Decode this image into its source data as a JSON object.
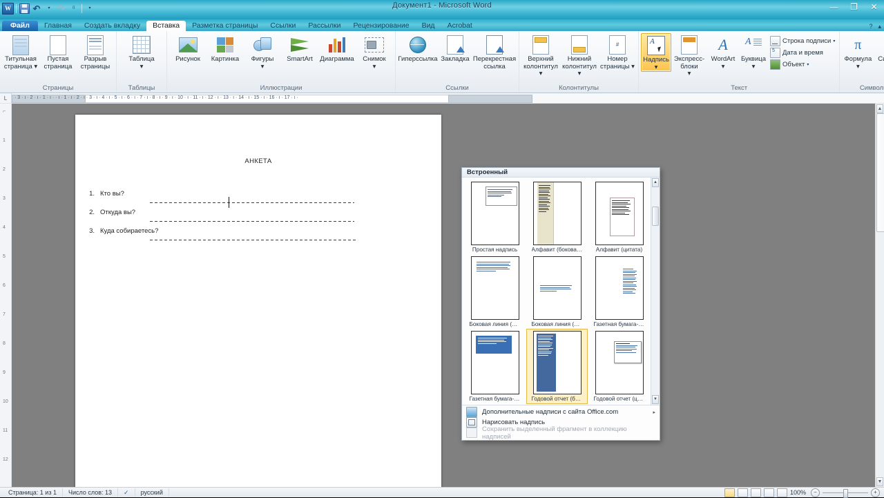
{
  "window": {
    "title": "Документ1 - Microsoft Word",
    "minimize": "—",
    "restore": "❐",
    "close": "✕"
  },
  "quick_access": {
    "word_logo": "W",
    "save": "save-icon",
    "undo": "↶",
    "undo_arrow": "▾",
    "redo": "↷",
    "customize": "▾"
  },
  "tabs": [
    {
      "label": "Файл",
      "kind": "file"
    },
    {
      "label": "Главная",
      "kind": "normal"
    },
    {
      "label": "Создать вкладку",
      "kind": "normal"
    },
    {
      "label": "Вставка",
      "kind": "active"
    },
    {
      "label": "Разметка страницы",
      "kind": "normal"
    },
    {
      "label": "Ссылки",
      "kind": "normal"
    },
    {
      "label": "Рассылки",
      "kind": "normal"
    },
    {
      "label": "Рецензирование",
      "kind": "normal"
    },
    {
      "label": "Вид",
      "kind": "normal"
    },
    {
      "label": "Acrobat",
      "kind": "normal"
    }
  ],
  "ribbon": {
    "groups": [
      {
        "label": "Страницы",
        "buttons": [
          {
            "label": "Титульная страница",
            "dropdown": true
          },
          {
            "label": "Пустая страница",
            "dropdown": false
          },
          {
            "label": "Разрыв страницы",
            "dropdown": false
          }
        ]
      },
      {
        "label": "Таблицы",
        "buttons": [
          {
            "label": "Таблица",
            "dropdown": true
          }
        ]
      },
      {
        "label": "Иллюстрации",
        "buttons": [
          {
            "label": "Рисунок",
            "dropdown": false
          },
          {
            "label": "Картинка",
            "dropdown": false
          },
          {
            "label": "Фигуры",
            "dropdown": true
          },
          {
            "label": "SmartArt",
            "dropdown": false
          },
          {
            "label": "Диаграмма",
            "dropdown": false
          },
          {
            "label": "Снимок",
            "dropdown": true
          }
        ]
      },
      {
        "label": "Ссылки",
        "buttons": [
          {
            "label": "Гиперссылка",
            "dropdown": false
          },
          {
            "label": "Закладка",
            "dropdown": false
          },
          {
            "label": "Перекрестная ссылка",
            "dropdown": false
          }
        ]
      },
      {
        "label": "Колонтитулы",
        "buttons": [
          {
            "label": "Верхний колонтитул",
            "dropdown": true
          },
          {
            "label": "Нижний колонтитул",
            "dropdown": true
          },
          {
            "label": "Номер страницы",
            "dropdown": true
          }
        ]
      },
      {
        "label": "Текст",
        "buttons": [
          {
            "label": "Надпись",
            "dropdown": true,
            "highlighted": true
          },
          {
            "label": "Экспресс-блоки",
            "dropdown": true
          },
          {
            "label": "WordArt",
            "dropdown": true
          },
          {
            "label": "Буквица",
            "dropdown": true
          }
        ],
        "small_buttons": [
          {
            "label": "Строка подписи",
            "dropdown": true
          },
          {
            "label": "Дата и время",
            "dropdown": false
          },
          {
            "label": "Объект",
            "dropdown": true
          }
        ]
      },
      {
        "label": "Символы",
        "buttons": [
          {
            "label": "Формула",
            "dropdown": true
          },
          {
            "label": "Символ",
            "dropdown": true
          }
        ]
      }
    ],
    "collapse_icon": "▴"
  },
  "ruler": {
    "corner_marker": "L",
    "ticks": "· 3 · ı · 2 · ı · 1 · ı ·      · ı · 1 · ı · 2 · ı · 3 · ı · 4 · ı · 5 · ı · 6 · ı · 7 · ı · 8 · ı · 9 · ı · 10 · ı · 11 · ı · 12 · ı · 13 · ı · 14 · ı · 15 · ı · 16 · ı · 17 · ı ·"
  },
  "document": {
    "title": "АНКЕТА",
    "questions": [
      {
        "num": "1.",
        "text": "Кто вы?"
      },
      {
        "num": "2.",
        "text": "Откуда вы?"
      },
      {
        "num": "3.",
        "text": "Куда собираетесь?"
      }
    ]
  },
  "gallery": {
    "header": "Встроенный",
    "scroll_up": "▲",
    "scroll_down": "▼",
    "items": [
      {
        "label": "Простая надпись",
        "style": "simple"
      },
      {
        "label": "Алфавит (боковая по...",
        "style": "alphabet-side"
      },
      {
        "label": "Алфавит (цитата)",
        "style": "alphabet-quote"
      },
      {
        "label": "Боковая линия (боко...",
        "style": "sideline-side"
      },
      {
        "label": "Боковая линия (цитата)",
        "style": "sideline-quote"
      },
      {
        "label": "Газетная бумага-боко...",
        "style": "news-side"
      },
      {
        "label": "Газетная бумага-брос...",
        "style": "news-pull"
      },
      {
        "label": "Годовой отчет (боков...",
        "style": "annual-side"
      },
      {
        "label": "Годовой отчет (цитата)",
        "style": "annual-quote"
      }
    ],
    "menu": [
      {
        "label": "Дополнительные надписи с сайта Office.com",
        "icon": "office-online-icon",
        "submenu": "▸",
        "disabled": false
      },
      {
        "label": "Нарисовать надпись",
        "icon": "draw-textbox-icon",
        "submenu": "",
        "disabled": false
      },
      {
        "label": "Сохранить выделенный фрагмент в коллекцию надписей",
        "icon": "save-selection-icon",
        "submenu": "",
        "disabled": true
      }
    ]
  },
  "status_bar": {
    "page": "Страница: 1 из 1",
    "words": "Число слов: 13",
    "proofing_icon": "spellcheck-icon",
    "language": "русский",
    "views": [
      "print-layout",
      "full-screen-reading",
      "web-layout",
      "outline",
      "draft"
    ],
    "zoom": "100%",
    "zoom_out": "−",
    "zoom_in": "+"
  }
}
